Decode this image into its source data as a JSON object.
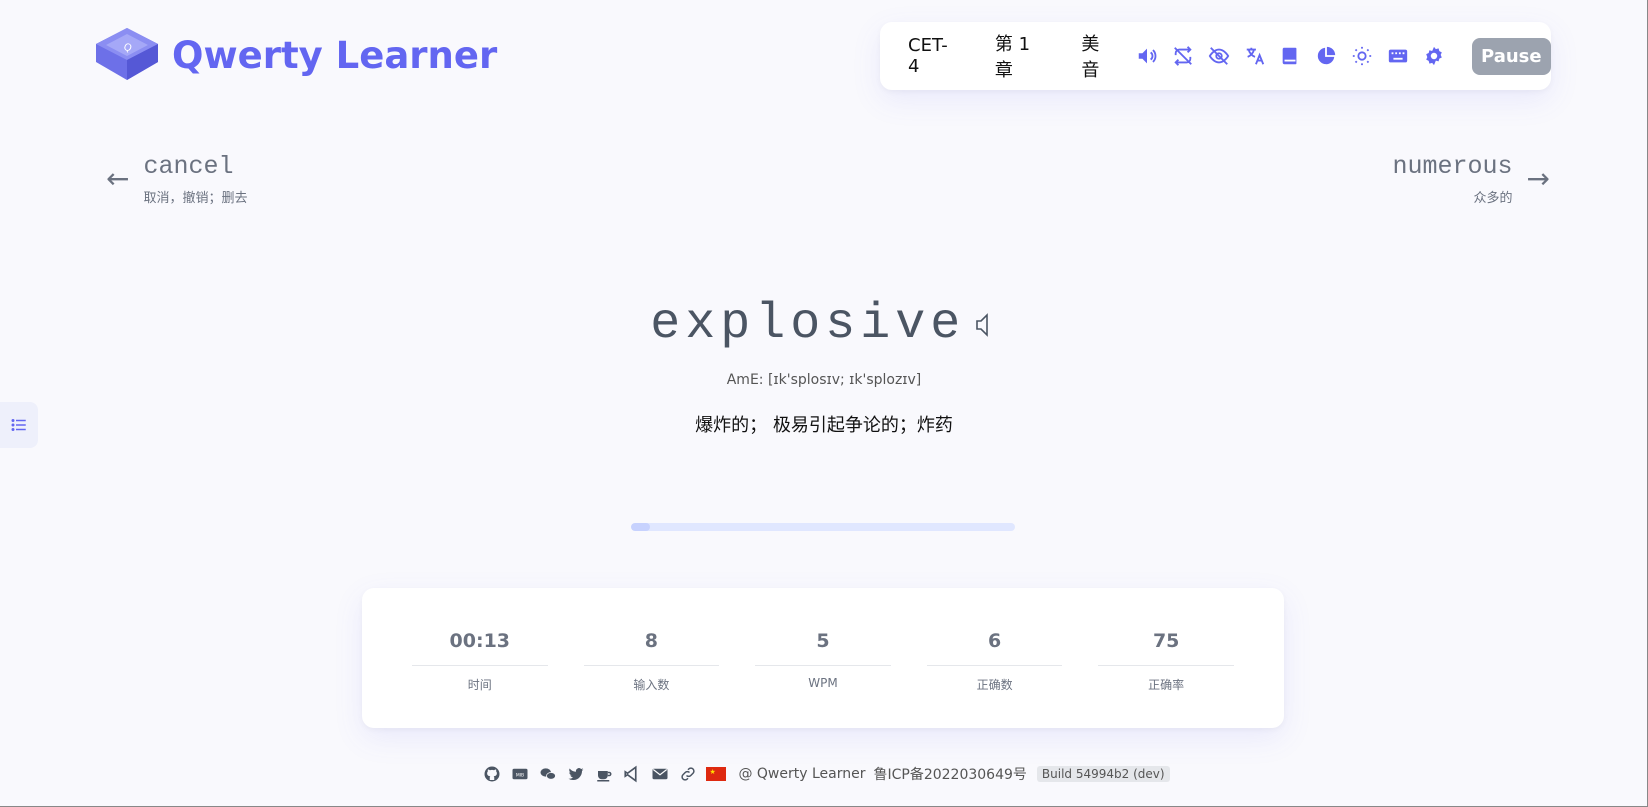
{
  "app": {
    "title": "Qwerty Learner"
  },
  "toolbar": {
    "dictionary": "CET-4",
    "chapter": "第 1 章",
    "accent": "美音",
    "icons": [
      "sound-icon",
      "loop-off-icon",
      "eye-off-icon",
      "translate-icon",
      "book-icon",
      "chart-pie-icon",
      "sun-icon",
      "keyboard-icon",
      "gear-icon"
    ],
    "pause_label": "Pause"
  },
  "prev_word": {
    "word": "cancel",
    "translation": "取消，撤销；删去"
  },
  "next_word": {
    "word": "numerous",
    "translation": "众多的"
  },
  "current_word": {
    "word": "explosive",
    "phonetic": "AmE: [ɪk'splosɪv; ɪk'splozɪv]",
    "translation": "爆炸的； 极易引起争论的；炸药"
  },
  "progress": {
    "fraction": 0.05
  },
  "stats": [
    {
      "value": "00:13",
      "label": "时间"
    },
    {
      "value": "8",
      "label": "输入数"
    },
    {
      "value": "5",
      "label": "WPM"
    },
    {
      "value": "6",
      "label": "正确数"
    },
    {
      "value": "75",
      "label": "正确率"
    }
  ],
  "footer": {
    "brand": "@ Qwerty Learner",
    "icp": "鲁ICP备2022030649号",
    "build": "Build 54994b2 (dev)"
  },
  "colors": {
    "accent": "#6366f1",
    "pause_bg": "#9ca3af",
    "background": "#f9f9fd"
  }
}
